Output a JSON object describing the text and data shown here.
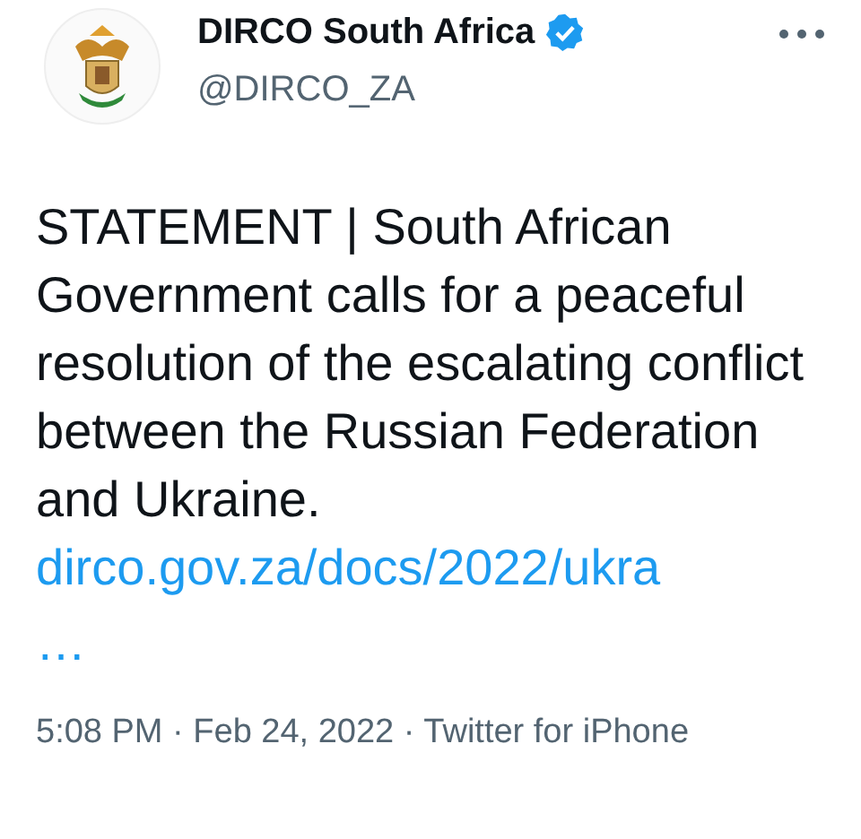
{
  "author": {
    "name": "DIRCO South Africa",
    "verified": true,
    "handle": "@DIRCO_ZA"
  },
  "tweet": {
    "text": "STATEMENT | South African Government calls for a peaceful resolution of the escalating conflict between the Russian Federation and Ukraine.",
    "link": "dirco.gov.za/docs/2022/ukra",
    "link_more": "…"
  },
  "meta": "5:08 PM · Feb 24, 2022 · Twitter for iPhone"
}
